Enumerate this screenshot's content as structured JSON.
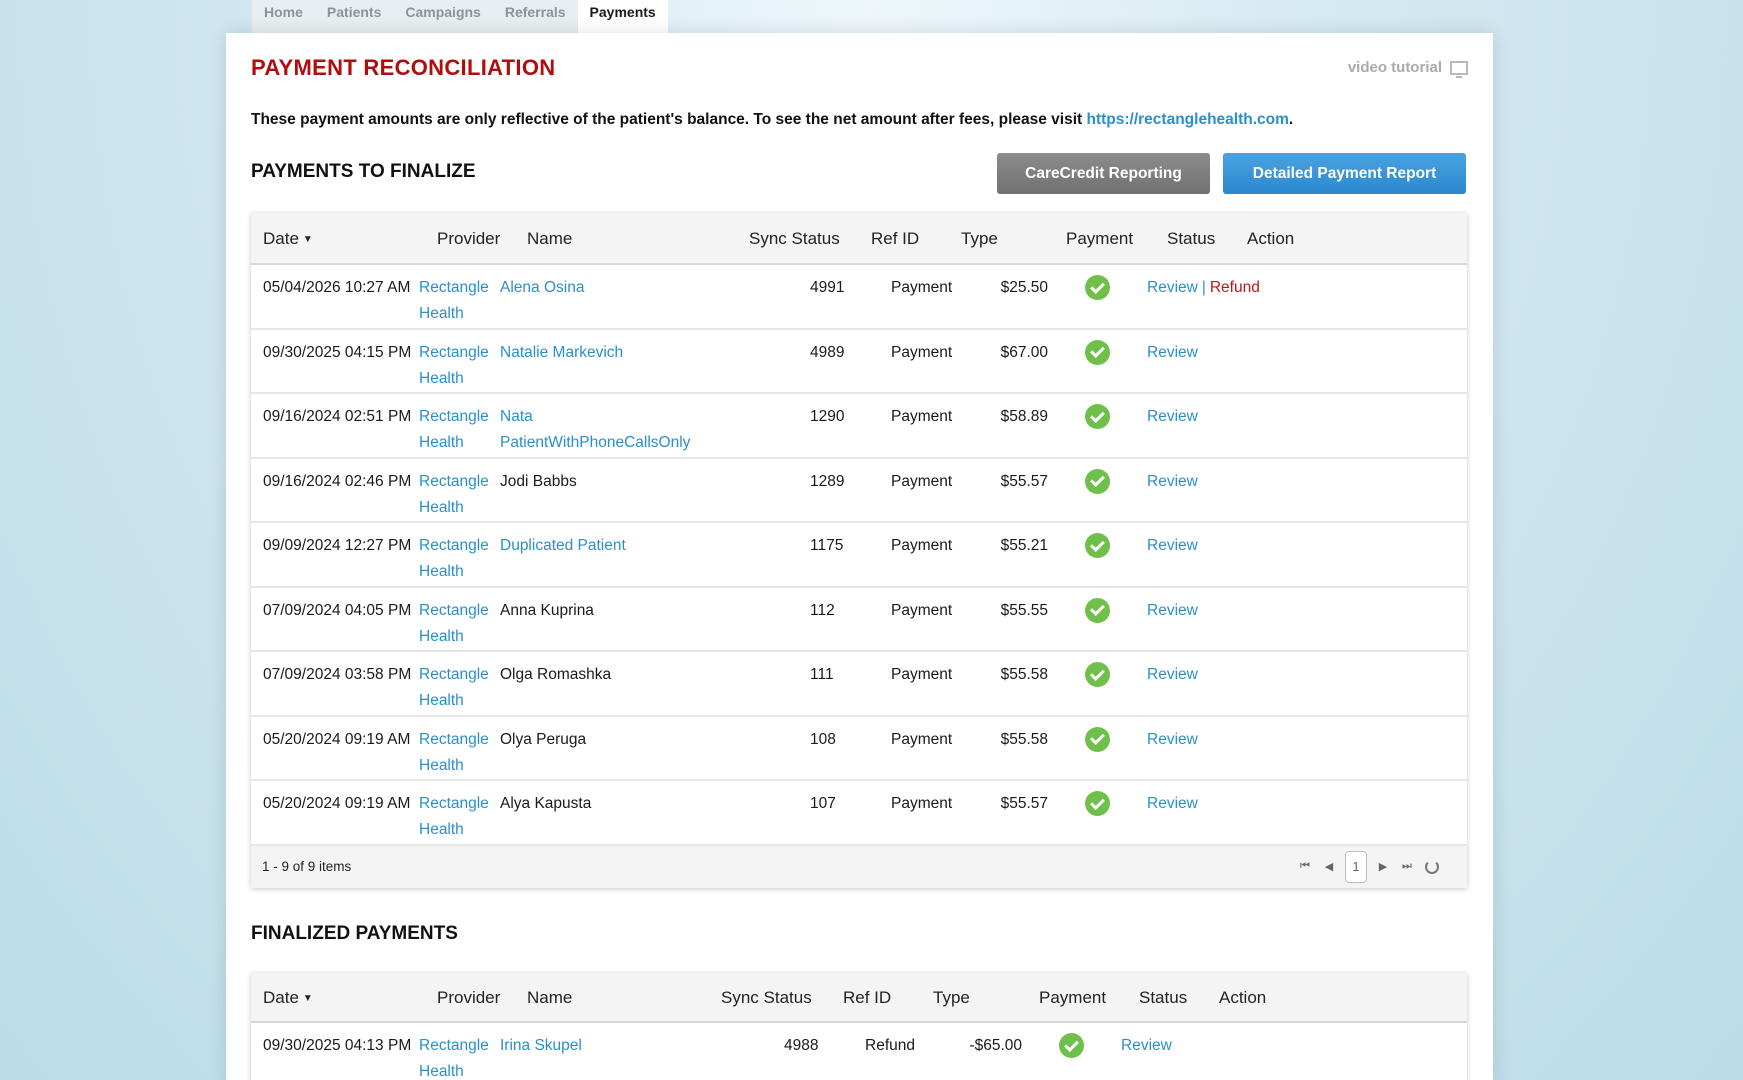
{
  "nav": {
    "tabs": [
      {
        "label": "Home"
      },
      {
        "label": "Patients"
      },
      {
        "label": "Campaigns"
      },
      {
        "label": "Referrals"
      },
      {
        "label": "Payments",
        "active": true
      }
    ]
  },
  "page": {
    "title": "PAYMENT RECONCILIATION",
    "video_tutorial": "video tutorial",
    "notice_text": "These payment amounts are only reflective of the patient's balance. To see the net amount after fees, please visit ",
    "notice_link": "https://rectanglehealth.com",
    "notice_end": "."
  },
  "finalize": {
    "title": "PAYMENTS TO FINALIZE",
    "carecredit_label": "CareCredit Reporting",
    "detailed_label": "Detailed Payment Report",
    "headers": {
      "date": "Date",
      "provider": "Provider",
      "name": "Name",
      "sync": "Sync Status",
      "ref": "Ref ID",
      "type": "Type",
      "payment": "Payment",
      "status": "Status",
      "action": "Action"
    },
    "rows": [
      {
        "date": "05/04/2026 10:27 AM",
        "provider1": "Rectangle",
        "provider2": "Health",
        "name1": "Alena Osina",
        "name2": "",
        "name_link": true,
        "ref": "4991",
        "type": "Payment",
        "payment": "$25.50",
        "review": "Review",
        "sep": "|",
        "refund": "Refund"
      },
      {
        "date": "09/30/2025 04:15 PM",
        "provider1": "Rectangle",
        "provider2": "Health",
        "name1": "Natalie Markevich",
        "name2": "",
        "name_link": true,
        "ref": "4989",
        "type": "Payment",
        "payment": "$67.00",
        "review": "Review",
        "sep": "",
        "refund": ""
      },
      {
        "date": "09/16/2024 02:51 PM",
        "provider1": "Rectangle",
        "provider2": "Health",
        "name1": "Nata",
        "name2": "PatientWithPhoneCallsOnly",
        "name_link": true,
        "ref": "1290",
        "type": "Payment",
        "payment": "$58.89",
        "review": "Review",
        "sep": "",
        "refund": ""
      },
      {
        "date": "09/16/2024 02:46 PM",
        "provider1": "Rectangle",
        "provider2": "Health",
        "name1": "Jodi Babbs",
        "name2": "",
        "name_link": false,
        "ref": "1289",
        "type": "Payment",
        "payment": "$55.57",
        "review": "Review",
        "sep": "",
        "refund": ""
      },
      {
        "date": "09/09/2024 12:27 PM",
        "provider1": "Rectangle",
        "provider2": "Health",
        "name1": "Duplicated Patient",
        "name2": "",
        "name_link": true,
        "ref": "1175",
        "type": "Payment",
        "payment": "$55.21",
        "review": "Review",
        "sep": "",
        "refund": ""
      },
      {
        "date": "07/09/2024 04:05 PM",
        "provider1": "Rectangle",
        "provider2": "Health",
        "name1": "Anna Kuprina",
        "name2": "",
        "name_link": false,
        "ref": "112",
        "type": "Payment",
        "payment": "$55.55",
        "review": "Review",
        "sep": "",
        "refund": ""
      },
      {
        "date": "07/09/2024 03:58 PM",
        "provider1": "Rectangle",
        "provider2": "Health",
        "name1": "Olga Romashka",
        "name2": "",
        "name_link": false,
        "ref": "111",
        "type": "Payment",
        "payment": "$55.58",
        "review": "Review",
        "sep": "",
        "refund": ""
      },
      {
        "date": "05/20/2024 09:19 AM",
        "provider1": "Rectangle",
        "provider2": "Health",
        "name1": "Olya Peruga",
        "name2": "",
        "name_link": false,
        "ref": "108",
        "type": "Payment",
        "payment": "$55.58",
        "review": "Review",
        "sep": "",
        "refund": ""
      },
      {
        "date": "05/20/2024 09:19 AM",
        "provider1": "Rectangle",
        "provider2": "Health",
        "name1": "Alya Kapusta",
        "name2": "",
        "name_link": false,
        "ref": "107",
        "type": "Payment",
        "payment": "$55.57",
        "review": "Review",
        "sep": "",
        "refund": ""
      }
    ],
    "footer_count": "1 - 9 of 9 items",
    "current_page": "1"
  },
  "finalized": {
    "title": "FINALIZED PAYMENTS",
    "headers": {
      "date": "Date",
      "provider": "Provider",
      "name": "Name",
      "sync": "Sync Status",
      "ref": "Ref ID",
      "type": "Type",
      "payment": "Payment",
      "status": "Status",
      "action": "Action"
    },
    "rows": [
      {
        "date": "09/30/2025 04:13 PM",
        "provider1": "Rectangle",
        "provider2": "Health",
        "name1": "Irina Skupel",
        "name2": "",
        "name_link": true,
        "ref": "4988",
        "type": "Refund",
        "payment": "-$65.00",
        "review": "Review",
        "sep": "",
        "refund": ""
      }
    ]
  },
  "icons": {
    "status": "check-circle-icon",
    "video": "monitor-icon",
    "sort": "sort-down-icon"
  },
  "colors": {
    "title_red": "#b00e0e",
    "link_blue": "#2a8fcb",
    "success_green": "#6fc04a",
    "primary_button": "#2b87cf",
    "secondary_button": "#7a7a7a"
  }
}
